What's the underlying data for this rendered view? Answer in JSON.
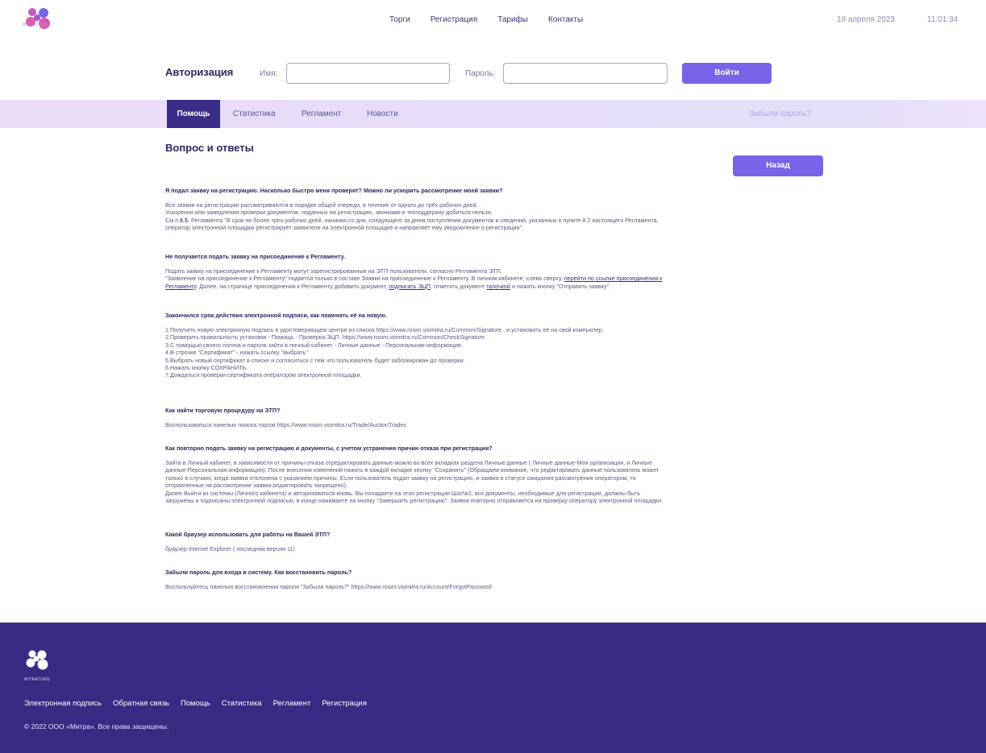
{
  "header": {
    "logo_text": "MITRATORG",
    "nav": [
      "Торги",
      "Регистрация",
      "Тарифы",
      "Контакты"
    ],
    "date": "19 апреля 2023",
    "time": "11:01:34"
  },
  "auth": {
    "title": "Авторизация",
    "name_label": "Имя:",
    "password_label": "Пароль:",
    "login_button": "Войти"
  },
  "tabs": {
    "items": [
      "Помощь",
      "Статистика",
      "Регламент",
      "Новости"
    ],
    "active": "Помощь",
    "forgot_password": "Забыли пароль?"
  },
  "content": {
    "title": "Вопрос и ответы",
    "back_button": "Назад",
    "qa": [
      {
        "q": "Я подал заявку на регистрацию. Насколько быстро меня проверят? Можно ли ускорить рассмотрение моей заявки?",
        "a1": "Все заявки на регистрацию рассматриваются в порядке общей очереди, в течение от одного до трёх рабочих дней.",
        "a2": "Ускорения или замедления проверки документов, поданных на регистрацию, звонками в техподдержку добиться нельзя.",
        "a3_pre": "См.п.",
        "a3_bold": "8.5.",
        "a3_post": " Регламента \"В срок не более трех рабочих дней, начиная со дня, следующего за днем поступления документов и сведений, указанных в пункте 8.2 настоящего Регламента,",
        "a4": "оператор электронной площадки регистрирует заявителя на электронной площадке и направляет ему уведомление о регистрации\"."
      },
      {
        "q": "Не получается подать заявку на присоединение к Регламенту.",
        "a1": "Подать заявку на присоединение к Регламенту могут зарегистрированные на ЭТП пользователи, согласно Регламента ЭТП.",
        "a2_pre": "\"Заявление на присоединение к Регламенту\" подается только в составе Заявки на присоединение к Регламенту. В личном кабинете, слева сверху, ",
        "a2_link": "перейти по ссылке присоединения к",
        "a3_link": "Регламенту",
        "a3_mid1": ". Далее, на странице присоединения к Регламенту добавить документ, ",
        "a3_link2": "подписать ЭЦП",
        "a3_mid2": ", отметить документ ",
        "a3_link3": "галочкой",
        "a3_post": " и нажать кнопку \"Отправить заявку\"."
      },
      {
        "q": "Закончился срок действия электронной подписи, как поменять её на новую.",
        "lines": [
          "1.Получить новую электронную подпись в удостоверяющем центре  из списка https://www.rosim.viomitra.ru/Common/Signature  , и установить  её на свой компьютер.",
          "2.Проверить правильность установки - Помощь - Проверка ЭЦП. https://www.rosim.viomitra.ru/Common/CheckSignature",
          "3.С помощью своего логина и пароля зайти в личный кабинет - Личные данные - Персональная информация.",
          "4.В строчке \"Сертификат\" - нажать ссылку \"выбрать\"",
          "5.Выбрать новый сертификат в списке и согласиться с тем что пользователь будет заблокирован до проверки.",
          "6.Нажать кнопку СОХРАНИТЬ.",
          "7.Дождаться проверки сертификата оператором электронной площадки."
        ]
      },
      {
        "q": "Как найти торговую процедуру на ЭТП?",
        "a1": "Воспользоваться панелью поиска торгов https://www.rosim.viomitra.ru/Trade/AuctionTrades"
      },
      {
        "q": "Как повторно подать заявку на регистрацию и документы, с учетом устранения причин отказа при регистрации?",
        "lines": [
          "Зайти в Личный кабинет, в зависимости от причины отказа отредактировать данные можно во всех вкладках раздела Личные данные ( Личные данные-Моя организация, и Личные",
          "данные-Персональная информация). После внесения изменений  нажать в каждой вкладке кнопку \"Сохранить\" (Обращаем внимание, что редактировать данные пользователь может",
          "только в случаях, когда заявка отклонена с указанием причины.  Если пользователь подал заявку на регистрацию, и заявка в статусе ожидания рассмотрения оператором, то",
          "отправленные на рассмотрение заявки редактировать запрещено).",
          "Далее  Выйти из системы (Личного кабинета) и авторизоваться вновь. Вы попадаете на этап регистрации Шаг№2, все документы, необходимые для регистрации, должны быть",
          "загружены и подписаны электронной подписью, в конце нажимаете на кнопку \"Завершить регистрацию\". Заявка повторно отправляется на проверку оператору электронной площадки."
        ]
      },
      {
        "q": "Какой браузер использовать для работы на Вашей ЭТП?",
        "a1": "браузер Internet Explorer ( последняя версия 11)"
      },
      {
        "q": "Забыли пароль для входа в систему. Как восстановить пароль?",
        "a1": "Воспользуйтесь панелью восстановления пароля \"Забыли пароль?\" https://www.rosim.viomitra.ru/Account/ForgotPassword"
      }
    ]
  },
  "footer": {
    "logo_text": "MITRATORG",
    "nav": [
      "Электронная подпись",
      "Обратная связь",
      "Помощь",
      "Статистика",
      "Регламент",
      "Регистрация"
    ],
    "copyright": "© 2022 ООО «Митра». Все права защищены."
  },
  "colors": {
    "brand_dark": "#3a2d87",
    "accent_button": "#7a63e8",
    "logo_pink": "#e05aa8",
    "logo_purple": "#7a63e8"
  }
}
